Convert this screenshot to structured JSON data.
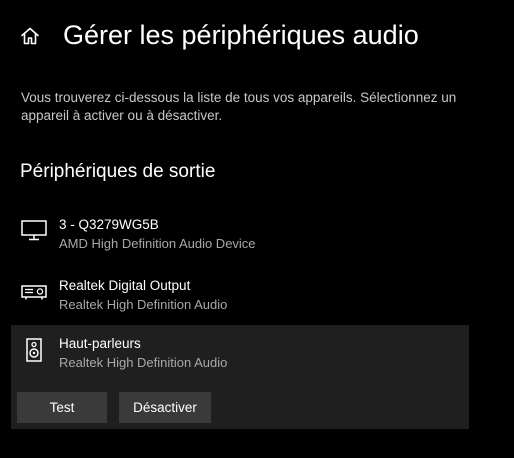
{
  "header": {
    "home_icon": "home-icon",
    "title": "Gérer les périphériques audio"
  },
  "description": "Vous trouverez ci-dessous la liste de tous vos appareils. Sélectionnez un appareil à activer ou à désactiver.",
  "output_section": {
    "title": "Périphériques de sortie",
    "devices": [
      {
        "icon": "monitor-icon",
        "name": "3 - Q3279WG5B",
        "driver": "AMD High Definition Audio Device",
        "selected": false
      },
      {
        "icon": "digital-output-icon",
        "name": "Realtek Digital Output",
        "driver": "Realtek High Definition Audio",
        "selected": false
      },
      {
        "icon": "speaker-icon",
        "name": "Haut-parleurs",
        "driver": "Realtek High Definition Audio",
        "selected": true,
        "actions": {
          "test_label": "Test",
          "deactivate_label": "Désactiver"
        }
      }
    ]
  },
  "colors": {
    "background": "#000000",
    "selected_background": "#1f1f1f",
    "button_background": "#3a3a3a",
    "secondary_text": "#a8a8a8"
  }
}
